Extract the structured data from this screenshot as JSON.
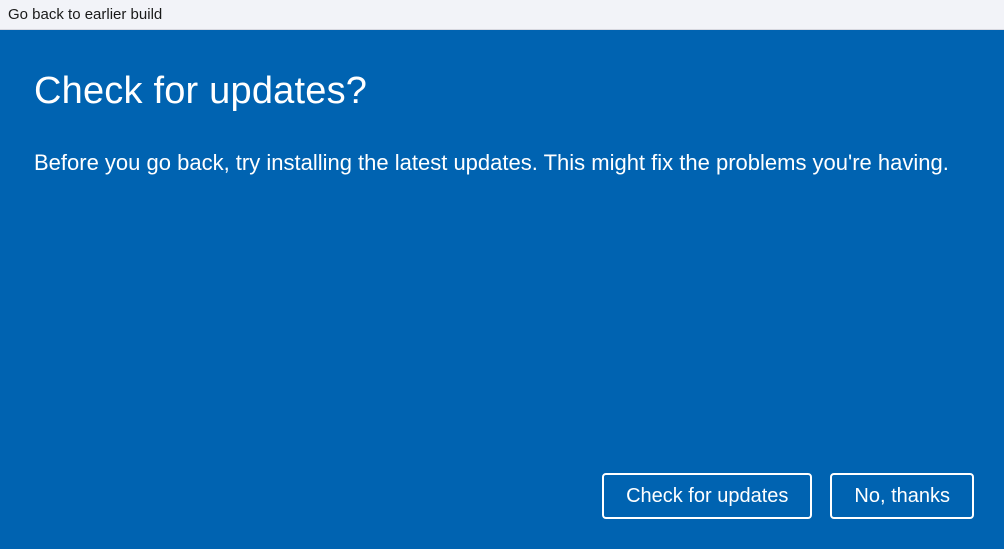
{
  "titleBar": {
    "text": "Go back to earlier build"
  },
  "main": {
    "heading": "Check for updates?",
    "body": "Before you go back, try installing the latest updates. This might fix the problems you're having."
  },
  "buttons": {
    "checkForUpdates": "Check for updates",
    "noThanks": "No, thanks"
  }
}
